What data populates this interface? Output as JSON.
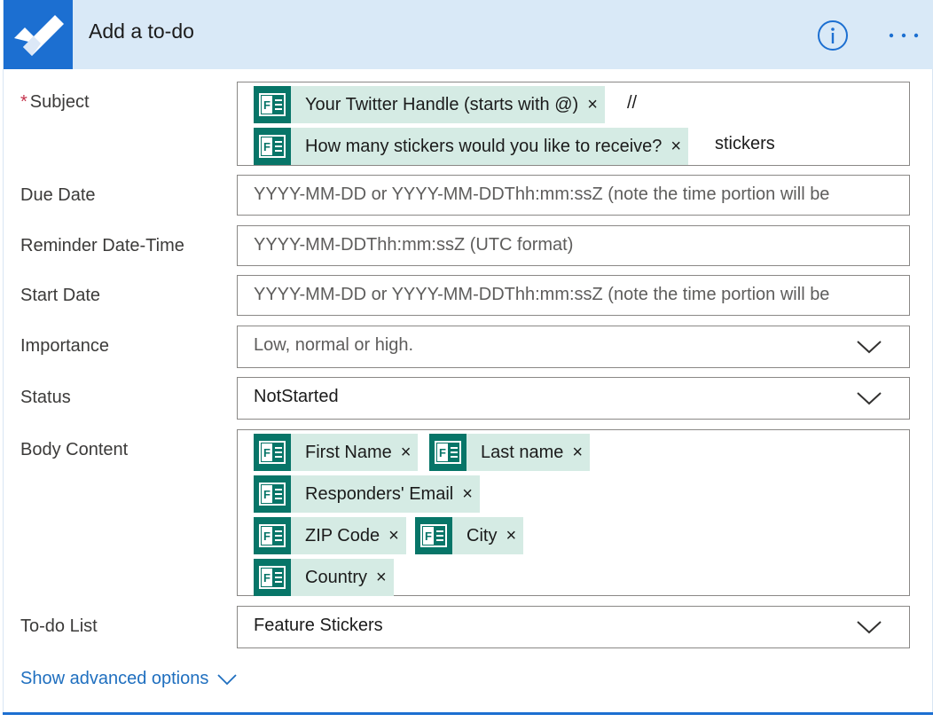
{
  "header": {
    "title": "Add a to-do",
    "app_icon": "checkmark-app-icon",
    "info_icon": "info-icon",
    "more_icon": "more-icon"
  },
  "colors": {
    "header_bg": "#d9e9f7",
    "brand_blue": "#1c6fd1",
    "token_green": "#077568",
    "token_bg": "#d5ebe4",
    "required": "#c4314b",
    "link": "#1f6fbf"
  },
  "fields": {
    "subject": {
      "required_mark": "*",
      "label": "Subject",
      "line1_token": "Your Twitter Handle (starts with @)",
      "line1_text": "//",
      "line2_token": "How many stickers would you like to receive?",
      "line2_text": "stickers"
    },
    "due_date": {
      "label": "Due Date",
      "placeholder": "YYYY-MM-DD or YYYY-MM-DDThh:mm:ssZ (note the time portion will be"
    },
    "reminder": {
      "label": "Reminder Date-Time",
      "placeholder": "YYYY-MM-DDThh:mm:ssZ (UTC format)"
    },
    "start_date": {
      "label": "Start Date",
      "placeholder": "YYYY-MM-DD or YYYY-MM-DDThh:mm:ssZ (note the time portion will be"
    },
    "importance": {
      "label": "Importance",
      "placeholder": "Low, normal or high."
    },
    "status": {
      "label": "Status",
      "value": "NotStarted"
    },
    "body": {
      "label": "Body Content",
      "tokens": [
        "First Name",
        "Last name",
        "Responders' Email",
        "ZIP Code",
        "City",
        "Country"
      ]
    },
    "todo_list": {
      "label": "To-do List",
      "value": "Feature Stickers"
    }
  },
  "token_remove": "×",
  "advanced": {
    "label": "Show advanced options"
  }
}
